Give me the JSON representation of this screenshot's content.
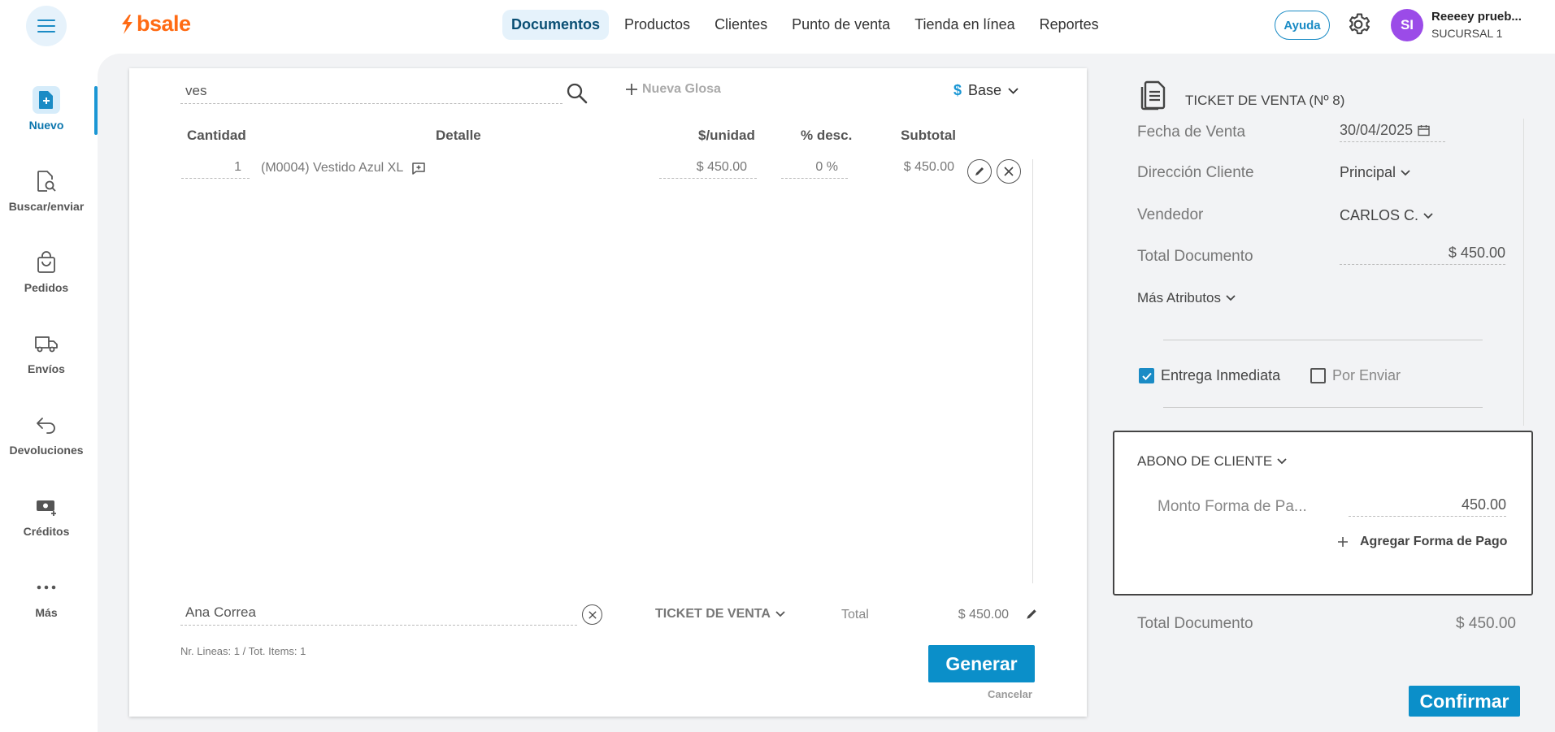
{
  "app": {
    "logo_text": "bsale",
    "brand_color": "#ff6a13",
    "accent_color": "#0b8fc9"
  },
  "topnav": {
    "items": [
      {
        "label": "Documentos",
        "active": true
      },
      {
        "label": "Productos"
      },
      {
        "label": "Clientes"
      },
      {
        "label": "Punto de venta"
      },
      {
        "label": "Tienda en línea"
      },
      {
        "label": "Reportes"
      }
    ],
    "help_label": "Ayuda",
    "avatar_initials": "SI",
    "user_name": "Reeeey prueb...",
    "user_branch": "SUCURSAL 1"
  },
  "sidebar": {
    "items": [
      {
        "label": "Nuevo",
        "icon": "new-document-icon",
        "active": true
      },
      {
        "label": "Buscar/enviar",
        "icon": "search-document-icon"
      },
      {
        "label": "Pedidos",
        "icon": "bag-icon"
      },
      {
        "label": "Envíos",
        "icon": "truck-icon"
      },
      {
        "label": "Devoluciones",
        "icon": "return-arrow-icon"
      },
      {
        "label": "Créditos",
        "icon": "cash-icon"
      },
      {
        "label": "Más",
        "icon": "more-dots-icon"
      }
    ]
  },
  "document": {
    "search_value": "ves",
    "nueva_glosa_label": "Nueva Glosa",
    "price_list_symbol": "$",
    "price_list_label": "Base",
    "columns": {
      "qty": "Cantidad",
      "detail": "Detalle",
      "unit_price": "$/unidad",
      "discount": "% desc.",
      "subtotal": "Subtotal"
    },
    "rows": [
      {
        "qty": "1",
        "detail": "(M0004) Vestido Azul XL",
        "unit_price": "$ 450.00",
        "discount": "0 %",
        "subtotal": "$ 450.00"
      }
    ],
    "client_value": "Ana Correa",
    "doc_type": "TICKET DE VENTA",
    "total_label": "Total",
    "total_value": "$ 450.00",
    "info_lines": "Nr. Lineas: 1 / Tot. Items: 1",
    "generar_label": "Generar",
    "cancelar_label": "Cancelar"
  },
  "right_panel": {
    "title": "TICKET DE VENTA (Nº 8)",
    "fecha_label": "Fecha de Venta",
    "fecha_value": "30/04/2025",
    "direccion_label": "Dirección Cliente",
    "direccion_value": "Principal",
    "vendedor_label": "Vendedor",
    "vendedor_value": "CARLOS C.",
    "total_doc_label": "Total Documento",
    "total_doc_value": "$ 450.00",
    "mas_atributos_label": "Más Atributos",
    "entrega_inmediata_label": "Entrega Inmediata",
    "entrega_inmediata_checked": true,
    "por_enviar_label": "Por Enviar",
    "por_enviar_checked": false,
    "abono_title": "ABONO DE CLIENTE",
    "monto_label": "Monto Forma de Pa...",
    "monto_value": "450.00",
    "agregar_label": "Agregar Forma de Pago",
    "footer_total_label": "Total Documento",
    "footer_total_value": "$ 450.00",
    "confirmar_label": "Confirmar"
  }
}
